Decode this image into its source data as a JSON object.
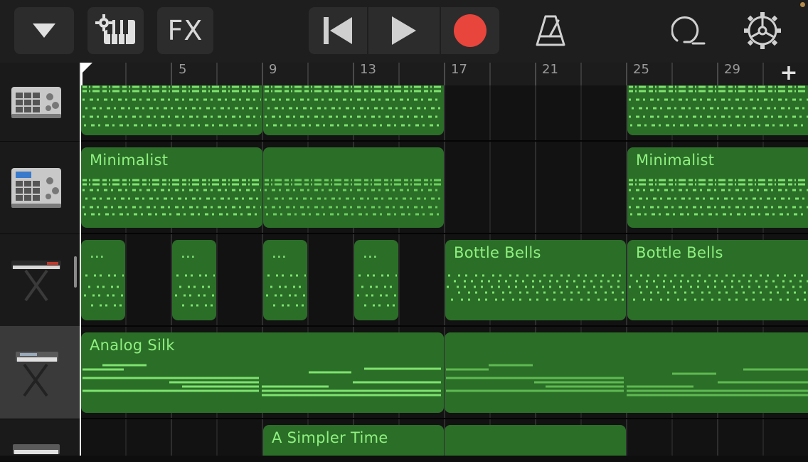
{
  "toolbar": {
    "fx_label": "FX",
    "icons": {
      "tracks": "triangle-down-icon",
      "instrument": "gear-keyboard-icon",
      "rewind": "skip-back-icon",
      "play": "play-icon",
      "record": "record-icon",
      "metronome": "metronome-icon",
      "loops": "loop-browser-icon",
      "settings": "settings-icon"
    },
    "record_color": "#e8453c"
  },
  "ruler": {
    "bar_numbers": [
      "5",
      "9",
      "13",
      "17",
      "21",
      "25",
      "29"
    ],
    "add_section_label": "+"
  },
  "tracks": [
    {
      "instrument": "drum-machine",
      "icon": "drum-machine-icon"
    },
    {
      "instrument": "drum-machine",
      "icon": "drum-machine-icon"
    },
    {
      "instrument": "keyboard",
      "icon": "keyboard-stand-icon"
    },
    {
      "instrument": "keyboard",
      "icon": "keyboard-stand-icon",
      "selected": true
    },
    {
      "instrument": "keyboard",
      "icon": "keyboard-stand-icon"
    }
  ],
  "regions": {
    "t2_r1": "Minimalist",
    "t2_r3": "Minimalist",
    "t3_r1": "...",
    "t3_r2": "...",
    "t3_r3": "...",
    "t3_r4": "...",
    "t3_r5": "Bottle Bells",
    "t3_r6": "Bottle Bells",
    "t4_r1": "Analog Silk",
    "t5_r1": "A Simpler Time"
  },
  "colors": {
    "region_fill": "#2b6e28",
    "region_text": "#8ff07f",
    "accent": "#e8453c"
  }
}
